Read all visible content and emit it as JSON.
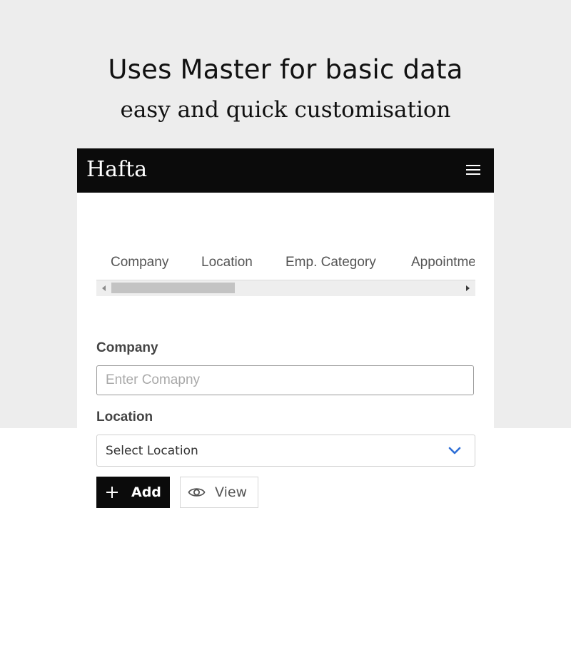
{
  "promo": {
    "headline": "Uses Master for basic data",
    "subheadline": "easy and quick customisation"
  },
  "navbar": {
    "brand": "Hafta",
    "menu_icon": "hamburger-menu-icon"
  },
  "tabs": [
    {
      "label": "Company"
    },
    {
      "label": "Location"
    },
    {
      "label": "Emp. Category"
    },
    {
      "label": "Appointment"
    }
  ],
  "form": {
    "company": {
      "label": "Company",
      "placeholder": "Enter Comapny",
      "value": ""
    },
    "location": {
      "label": "Location",
      "selected": "Select Location",
      "icon": "chevron-down-icon"
    }
  },
  "actions": {
    "add_label": "Add",
    "add_icon": "plus-icon",
    "view_label": "View",
    "view_icon": "eye-icon"
  },
  "colors": {
    "navbar_bg": "#0b0b0b",
    "promo_bg": "#ededed",
    "chevron": "#2f6fd6"
  }
}
